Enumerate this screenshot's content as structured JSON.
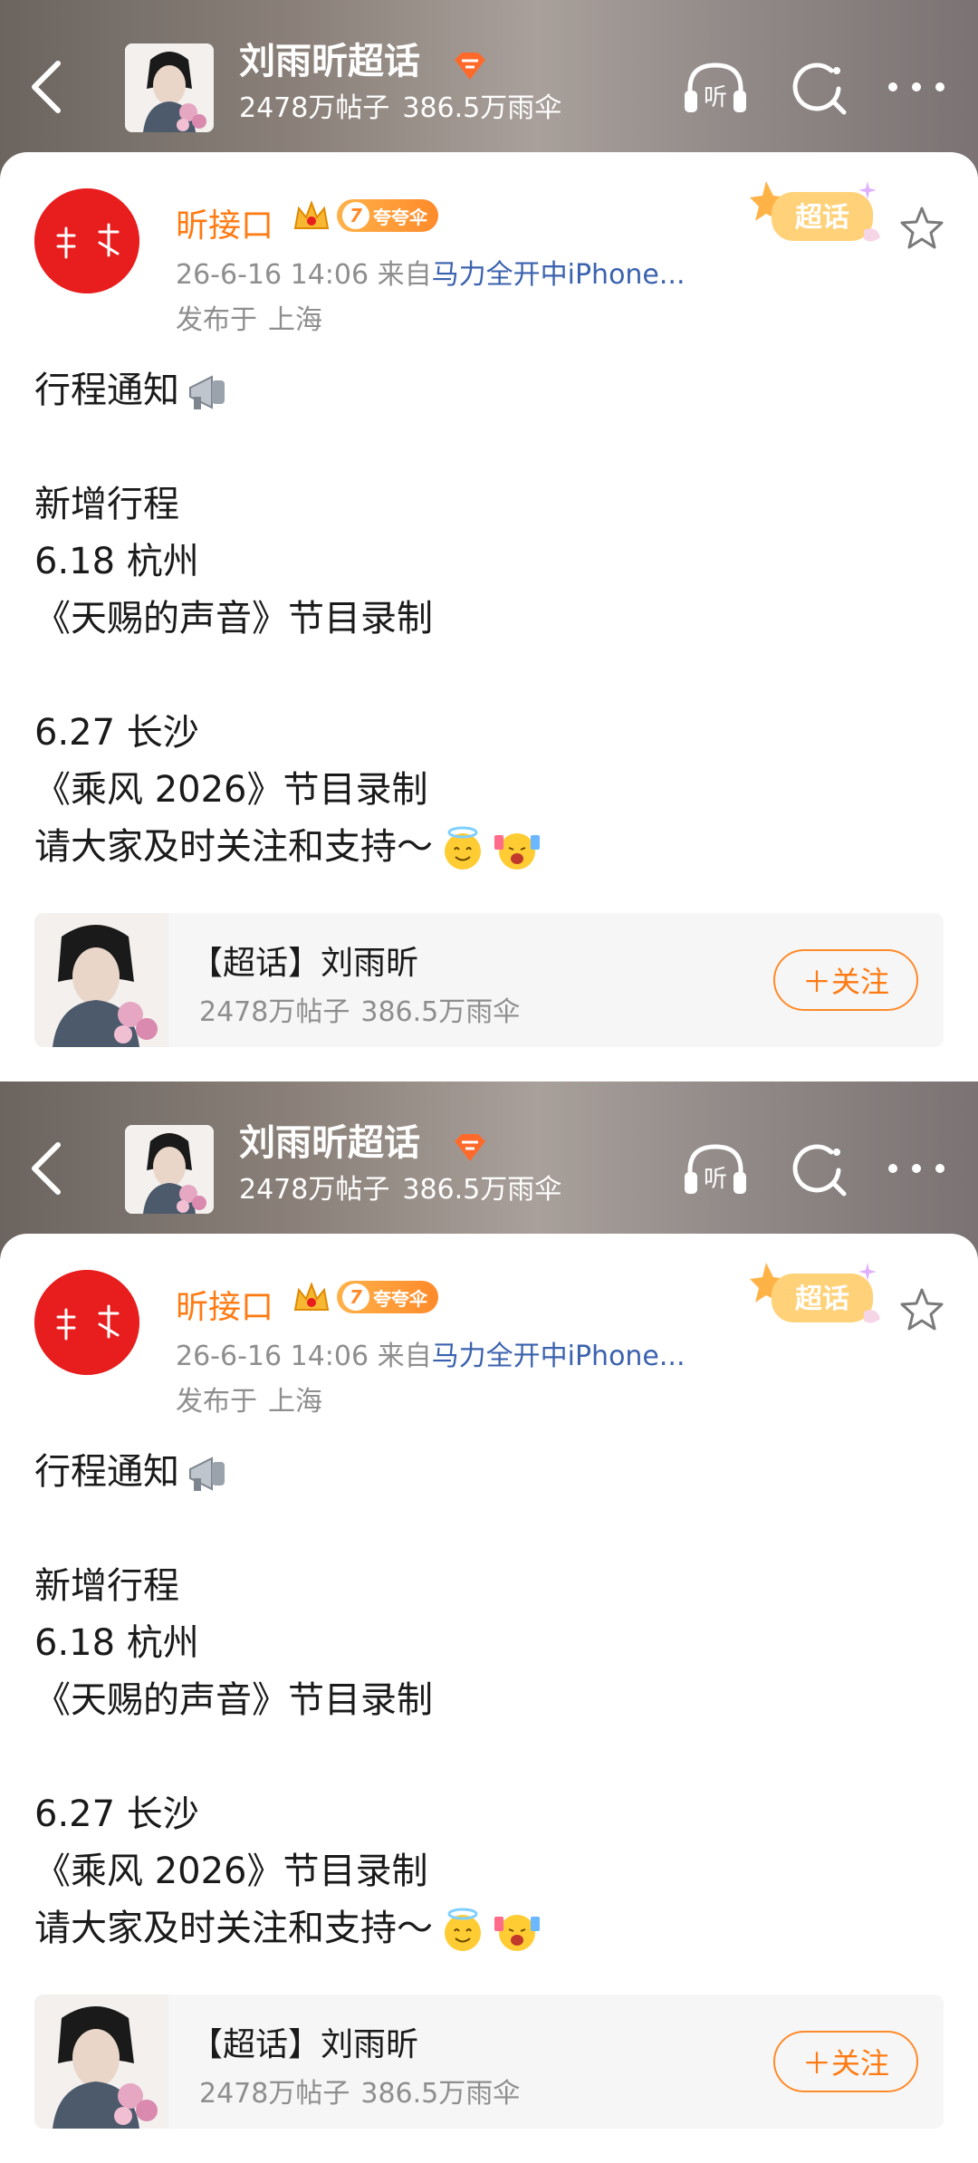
{
  "header": {
    "title": "刘雨昕超话",
    "stats": [
      "2478万帖子",
      "386.5万雨伞"
    ],
    "listen_icon": "listen-headphones-icon",
    "refresh_icon": "refresh-search-icon",
    "more_icon": "more-dots-icon"
  },
  "post": {
    "author": "昕接口",
    "level": "7",
    "level_label": "夸夸伞",
    "timestamp": "26-6-16 14:06",
    "source_prefix": "来自",
    "source": "马力全开中iPhone...",
    "location_prefix": "发布于",
    "location": "上海",
    "sticker_label": "超话",
    "lines": [
      "行程通知",
      "",
      "新增行程",
      "6.18 杭州",
      "《天赐的声音》节目录制",
      "",
      "6.27 长沙",
      "《乘风 2026》节目录制",
      "请大家及时关注和支持～"
    ]
  },
  "topic_card": {
    "title": "【超话】刘雨昕",
    "stats": [
      "2478万帖子",
      "386.5万雨伞"
    ],
    "follow_label": "＋关注"
  },
  "colors": {
    "accent": "#ff7a12",
    "avatar_bg": "#e81d1d",
    "link": "#3b62ae"
  }
}
